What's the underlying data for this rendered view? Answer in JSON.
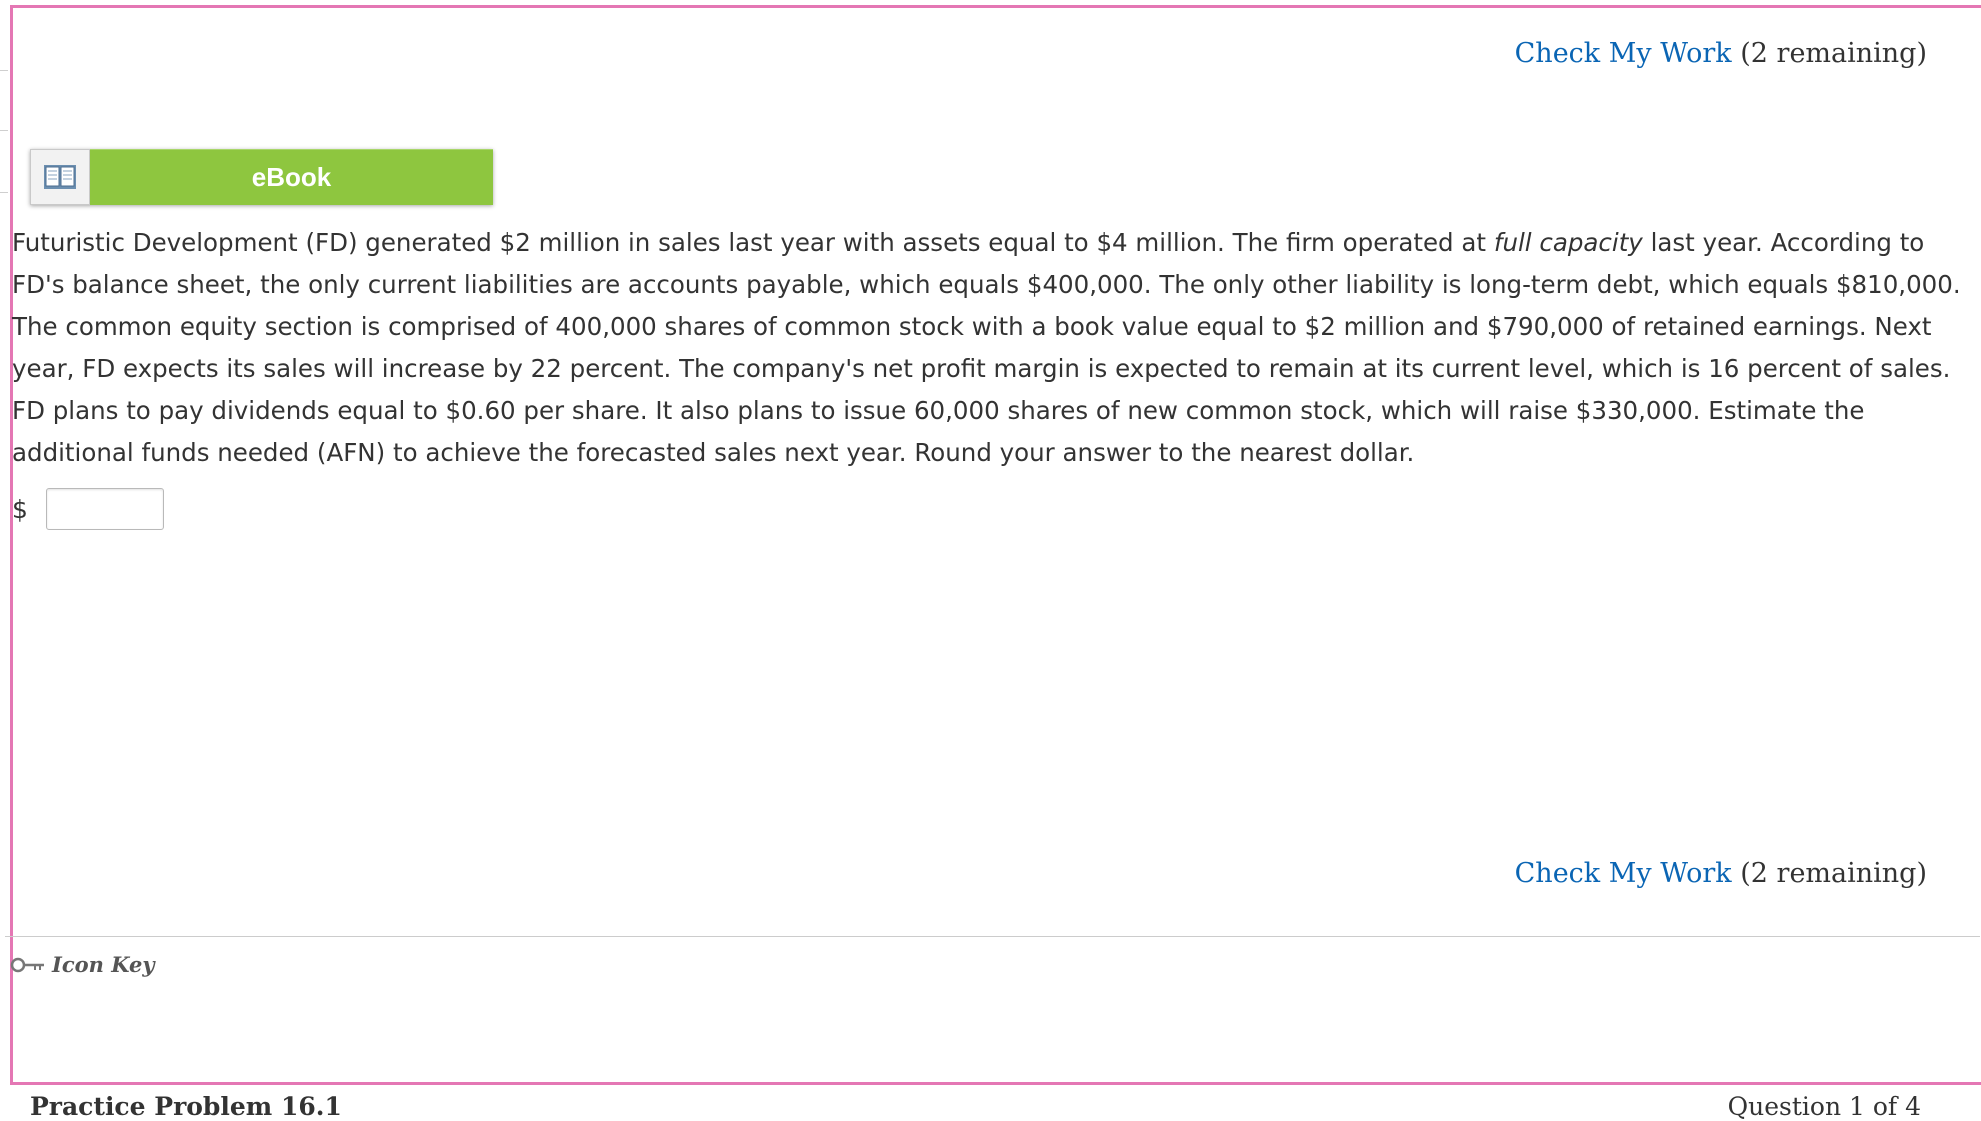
{
  "check_my_work": {
    "link_label": "Check My Work",
    "remaining": "(2 remaining)"
  },
  "ebook": {
    "label": "eBook",
    "icon": "book-icon"
  },
  "question": {
    "part1": "Futuristic Development (FD) generated $2 million in sales last year with assets equal to $4 million. The firm operated at ",
    "emphasis": "full capacity",
    "part2": " last year. According to FD's balance sheet, the only current liabilities are accounts payable, which equals $400,000. The only other liability is long-term debt, which equals $810,000. The common equity section is comprised of 400,000 shares of common stock with a book value equal to $2 million and $790,000 of retained earnings. Next year, FD expects its sales will increase by 22 percent. The company's net profit margin is expected to remain at its current level, which is 16 percent of sales. FD plans to pay dividends equal to $0.60 per share. It also plans to issue 60,000 shares of new common stock, which will raise $330,000. Estimate the additional funds needed (AFN) to achieve the forecasted sales next year. Round your answer to the nearest dollar."
  },
  "answer": {
    "currency": "$",
    "value": ""
  },
  "icon_key": {
    "label": "Icon Key",
    "icon": "key-icon"
  },
  "footer": {
    "practice_title": "Practice Problem 16.1",
    "question_count": "Question 1 of 4"
  },
  "colors": {
    "frame_border": "#e477b4",
    "link": "#0a65b4",
    "ebook_green": "#8ec63f"
  }
}
